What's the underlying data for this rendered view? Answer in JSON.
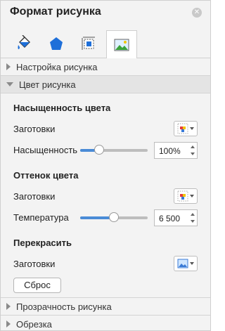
{
  "panel": {
    "title": "Формат рисунка",
    "close_icon": "close-icon"
  },
  "tabs": [
    {
      "name": "fill-line",
      "icon": "paint-bucket-icon"
    },
    {
      "name": "effects",
      "icon": "pentagon-icon"
    },
    {
      "name": "size-properties",
      "icon": "size-icon"
    },
    {
      "name": "picture",
      "icon": "picture-icon",
      "active": true
    }
  ],
  "sections": {
    "picture_settings": {
      "label": "Настройка рисунка",
      "expanded": false
    },
    "picture_color": {
      "label": "Цвет рисунка",
      "expanded": true
    },
    "transparency": {
      "label": "Прозрачность рисунка",
      "expanded": false
    },
    "crop": {
      "label": "Обрезка",
      "expanded": false
    }
  },
  "color": {
    "saturation": {
      "heading": "Насыщенность цвета",
      "presets_label": "Заготовки",
      "value_label": "Насыщенность",
      "value": "100%",
      "level": 0.28
    },
    "tone": {
      "heading": "Оттенок цвета",
      "presets_label": "Заготовки",
      "value_label": "Температура",
      "value": "6 500",
      "level": 0.5
    },
    "recolor": {
      "heading": "Перекрасить",
      "presets_label": "Заготовки"
    },
    "reset_label": "Сброс"
  },
  "colors": {
    "accent": "#4a8bd6",
    "tab_icon_blue": "#1e6fd9"
  }
}
